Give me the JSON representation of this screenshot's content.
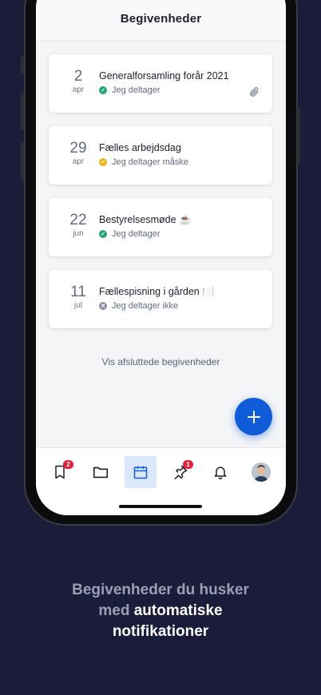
{
  "header": {
    "title": "Begivenheder"
  },
  "events": [
    {
      "day": "2",
      "month": "apr",
      "title": "Generalforsamling forår 2021",
      "status": "Jeg deltager",
      "status_color": "#27a37a",
      "status_icon": "check-icon",
      "has_attachment": true
    },
    {
      "day": "29",
      "month": "apr",
      "title": "Fælles arbejdsdag",
      "status": "Jeg deltager måske",
      "status_color": "#f0b21d",
      "status_icon": "check-icon",
      "has_attachment": false
    },
    {
      "day": "22",
      "month": "jun",
      "title": "Bestyrelsesmøde ☕",
      "status": "Jeg deltager",
      "status_color": "#27a37a",
      "status_icon": "check-icon",
      "has_attachment": false
    },
    {
      "day": "11",
      "month": "jul",
      "title": "Fællespisning i gården 🍽️",
      "status": "Jeg deltager ikke",
      "status_color": "#8a93a4",
      "status_icon": "x-icon",
      "has_attachment": false
    }
  ],
  "finished_link": "Vis afsluttede begivenheder",
  "fab": {
    "icon": "plus-icon"
  },
  "tabbar": {
    "tabs": [
      {
        "name": "bookmarks",
        "badge": "2"
      },
      {
        "name": "folder"
      },
      {
        "name": "calendar",
        "active": true
      },
      {
        "name": "pin",
        "badge": "1"
      },
      {
        "name": "bell"
      },
      {
        "name": "profile"
      }
    ]
  },
  "caption": {
    "part1": "Begivenheder du husker",
    "part2": "med ",
    "part3": "automatiske",
    "part4": "notifikationer"
  },
  "colors": {
    "background": "#1b1c3a",
    "accent": "#0f5bd8",
    "badge": "#e0243b"
  }
}
